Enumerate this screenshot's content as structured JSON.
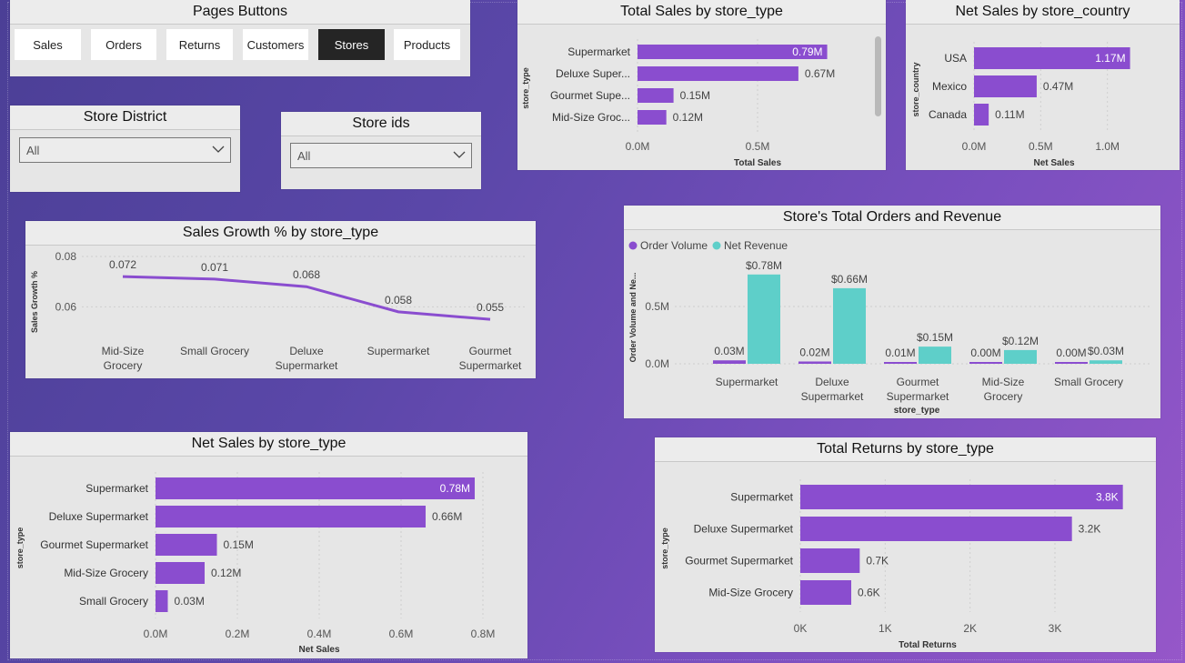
{
  "pages_panel": {
    "title": "Pages Buttons",
    "buttons": [
      "Sales",
      "Orders",
      "Returns",
      "Customers",
      "Stores",
      "Products"
    ],
    "active": "Stores"
  },
  "filters": {
    "district": {
      "title": "Store District",
      "value": "All"
    },
    "store_ids": {
      "title": "Store ids",
      "value": "All"
    }
  },
  "colors": {
    "purple": "#8a4dcf",
    "teal": "#5ecfc9",
    "dark": "#252525"
  },
  "chart_data": [
    {
      "id": "total_sales_by_store_type",
      "type": "bar",
      "orientation": "horizontal",
      "title": "Total Sales by store_type",
      "categories": [
        "Supermarket",
        "Deluxe Super...",
        "Gourmet Supe...",
        "Mid-Size Groc..."
      ],
      "values": [
        0.79,
        0.67,
        0.15,
        0.12
      ],
      "labels": [
        "0.79M",
        "0.67M",
        "0.15M",
        "0.12M"
      ],
      "xlabel": "Total Sales",
      "ylabel": "store_type",
      "ticks": [
        "0.0M",
        "0.5M"
      ],
      "xlim": [
        0,
        1.0
      ]
    },
    {
      "id": "net_sales_by_store_country",
      "type": "bar",
      "orientation": "horizontal",
      "title": "Net Sales by store_country",
      "categories": [
        "USA",
        "Mexico",
        "Canada"
      ],
      "values": [
        1.17,
        0.47,
        0.11
      ],
      "labels": [
        "1.17M",
        "0.47M",
        "0.11M"
      ],
      "xlabel": "Net Sales",
      "ylabel": "store_country",
      "ticks": [
        "0.0M",
        "0.5M",
        "1.0M"
      ],
      "xlim": [
        0,
        1.2
      ]
    },
    {
      "id": "sales_growth_by_store_type",
      "type": "line",
      "title": "Sales Growth % by store_type",
      "categories": [
        "Mid-Size Grocery",
        "Small Grocery",
        "Deluxe Supermarket",
        "Supermarket",
        "Gourmet Supermarket"
      ],
      "cat_lines": [
        [
          "Mid-Size",
          "Grocery"
        ],
        [
          "Small Grocery"
        ],
        [
          "Deluxe",
          "Supermarket"
        ],
        [
          "Supermarket"
        ],
        [
          "Gourmet",
          "Supermarket"
        ]
      ],
      "values": [
        0.072,
        0.071,
        0.068,
        0.058,
        0.055
      ],
      "labels": [
        "0.072",
        "0.071",
        "0.068",
        "0.058",
        "0.055"
      ],
      "ylabel": "Sales Growth %",
      "ticks": [
        "0.08",
        "0.06"
      ],
      "ylim": [
        0.05,
        0.08
      ]
    },
    {
      "id": "store_orders_revenue",
      "type": "bar",
      "orientation": "vertical",
      "title": "Store's Total Orders and Revenue",
      "categories": [
        "Supermarket",
        "Deluxe Supermarket",
        "Gourmet Supermarket",
        "Mid-Size Grocery",
        "Small Grocery"
      ],
      "cat_lines": [
        [
          "Supermarket"
        ],
        [
          "Deluxe",
          "Supermarket"
        ],
        [
          "Gourmet",
          "Supermarket"
        ],
        [
          "Mid-Size",
          "Grocery"
        ],
        [
          "Small Grocery"
        ]
      ],
      "series": [
        {
          "name": "Order Volume",
          "values": [
            0.03,
            0.02,
            0.01,
            0.0,
            0.0
          ],
          "labels": [
            "0.03M",
            "0.02M",
            "0.01M",
            "0.00M",
            "0.00M"
          ]
        },
        {
          "name": "Net Revenue",
          "values": [
            0.78,
            0.66,
            0.15,
            0.12,
            0.03
          ],
          "labels": [
            "$0.78M",
            "$0.66M",
            "$0.15M",
            "$0.12M",
            "$0.03M"
          ]
        }
      ],
      "xlabel": "store_type",
      "ylabel": "Order Volume and Ne...",
      "ticks": [
        "0.5M",
        "0.0M"
      ],
      "ylim": [
        0,
        0.85
      ]
    },
    {
      "id": "net_sales_by_store_type",
      "type": "bar",
      "orientation": "horizontal",
      "title": "Net Sales by store_type",
      "categories": [
        "Supermarket",
        "Deluxe Supermarket",
        "Gourmet Supermarket",
        "Mid-Size Grocery",
        "Small Grocery"
      ],
      "values": [
        0.78,
        0.66,
        0.15,
        0.12,
        0.03
      ],
      "labels": [
        "0.78M",
        "0.66M",
        "0.15M",
        "0.12M",
        "0.03M"
      ],
      "xlabel": "Net Sales",
      "ylabel": "store_type",
      "ticks": [
        "0.0M",
        "0.2M",
        "0.4M",
        "0.6M",
        "0.8M"
      ],
      "xlim": [
        0,
        0.8
      ]
    },
    {
      "id": "total_returns_by_store_type",
      "type": "bar",
      "orientation": "horizontal",
      "title": "Total Returns by store_type",
      "categories": [
        "Supermarket",
        "Deluxe Supermarket",
        "Gourmet Supermarket",
        "Mid-Size Grocery"
      ],
      "values": [
        3.8,
        3.2,
        0.7,
        0.6
      ],
      "labels": [
        "3.8K",
        "3.2K",
        "0.7K",
        "0.6K"
      ],
      "xlabel": "Total Returns",
      "ylabel": "store_type",
      "ticks": [
        "0K",
        "1K",
        "2K",
        "3K"
      ],
      "xlim": [
        0,
        3
      ]
    }
  ]
}
